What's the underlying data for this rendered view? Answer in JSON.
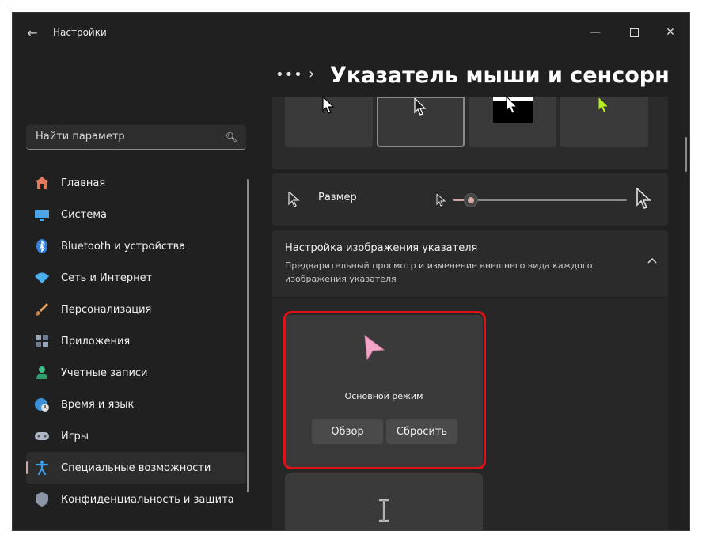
{
  "window": {
    "title": "Настройки"
  },
  "search": {
    "placeholder": "Найти параметр"
  },
  "sidebar": {
    "items": [
      {
        "label": "Главная",
        "icon": "home-icon",
        "color": "#e07a5a"
      },
      {
        "label": "Система",
        "icon": "display-icon",
        "color": "#4aa6e8"
      },
      {
        "label": "Bluetooth и устройства",
        "icon": "bluetooth-icon",
        "color": "#2f7fe0"
      },
      {
        "label": "Сеть и Интернет",
        "icon": "wifi-icon",
        "color": "#4ab0f0"
      },
      {
        "label": "Персонализация",
        "icon": "brush-icon",
        "color": "#e8a35a"
      },
      {
        "label": "Приложения",
        "icon": "apps-icon",
        "color": "#9aa6b8"
      },
      {
        "label": "Учетные записи",
        "icon": "person-icon",
        "color": "#3fc08a"
      },
      {
        "label": "Время и язык",
        "icon": "globe-clock-icon",
        "color": "#3a8fd6"
      },
      {
        "label": "Игры",
        "icon": "gamepad-icon",
        "color": "#b0b8c8"
      },
      {
        "label": "Специальные возможности",
        "icon": "accessibility-icon",
        "color": "#3a9ef0",
        "active": true
      },
      {
        "label": "Конфиденциальность и защита",
        "icon": "shield-icon",
        "color": "#8a96a8"
      }
    ]
  },
  "header": {
    "ellipsis": "•••",
    "chevron": "›",
    "title": "Указатель мыши и сенсорный ввод"
  },
  "size": {
    "label": "Размер",
    "slider_value": 0.1
  },
  "custom": {
    "title": "Настройка изображения указателя",
    "description": "Предварительный просмотр и изменение внешнего вида каждого изображения указателя"
  },
  "cursor_tile": {
    "name": "Основной режим",
    "browse_label": "Обзор",
    "reset_label": "Сбросить",
    "cursor_color": "#f4a6c8"
  },
  "colors": {
    "accent": "#d0a8a4",
    "highlight": "#e0101a"
  }
}
